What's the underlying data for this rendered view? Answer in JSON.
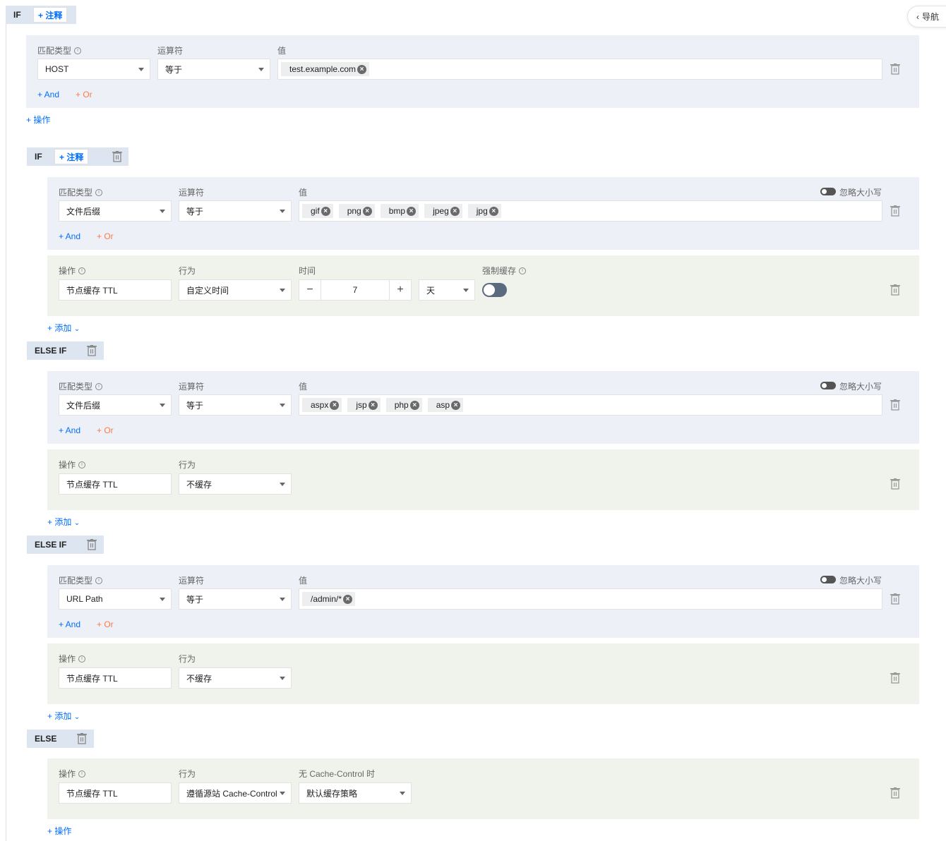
{
  "nav": {
    "label": "导航"
  },
  "labels": {
    "if": "IF",
    "else_if": "ELSE IF",
    "else": "ELSE",
    "note": "+ 注释",
    "match_type": "匹配类型",
    "operator": "运算符",
    "value": "值",
    "ignore_case": "忽略大小写",
    "action": "操作",
    "behavior": "行为",
    "time": "时间",
    "force_cache": "强制缓存",
    "no_cache_control": "无 Cache-Control 时",
    "and": "+ And",
    "or": "+ Or",
    "add_action": "+ 操作",
    "add": "+ 添加"
  },
  "rule0": {
    "match_type": "HOST",
    "operator": "等于",
    "values": [
      "test.example.com"
    ]
  },
  "rule1": {
    "match_type": "文件后缀",
    "operator": "等于",
    "values": [
      "gif",
      "png",
      "bmp",
      "jpeg",
      "jpg"
    ],
    "action": {
      "op": "节点缓存 TTL",
      "behavior": "自定义时间",
      "time": "7",
      "unit": "天",
      "force_cache": false
    }
  },
  "rule2": {
    "match_type": "文件后缀",
    "operator": "等于",
    "values": [
      "aspx",
      "jsp",
      "php",
      "asp"
    ],
    "action": {
      "op": "节点缓存 TTL",
      "behavior": "不缓存"
    }
  },
  "rule3": {
    "match_type": "URL Path",
    "operator": "等于",
    "values": [
      "/admin/*"
    ],
    "action": {
      "op": "节点缓存 TTL",
      "behavior": "不缓存"
    }
  },
  "rule4": {
    "action": {
      "op": "节点缓存 TTL",
      "behavior": "遵循源站 Cache-Control",
      "fallback": "默认缓存策略"
    }
  },
  "colors": {
    "accent": "#006eff",
    "or": "#ff7a45",
    "cond_bg": "#edf0f7",
    "act_bg": "#f0f2ec",
    "tag_bg": "#dde5f1"
  }
}
